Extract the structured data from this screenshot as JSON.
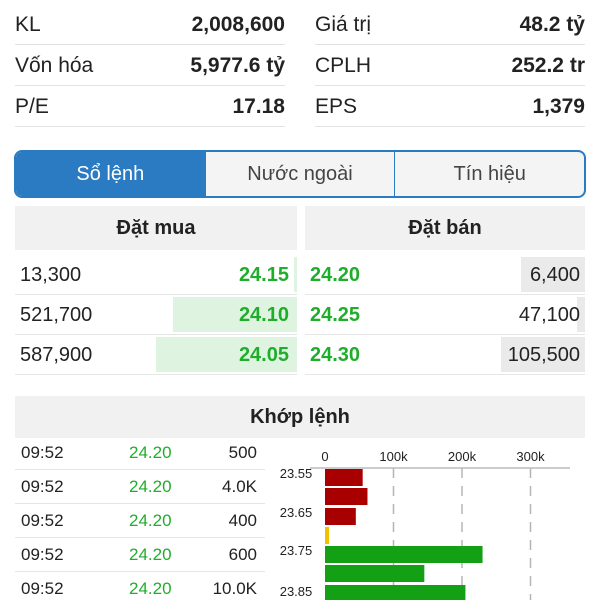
{
  "stats": {
    "left": [
      {
        "label": "KL",
        "value": "2,008,600"
      },
      {
        "label": "Vốn hóa",
        "value": "5,977.6 tỷ"
      },
      {
        "label": "P/E",
        "value": "17.18"
      }
    ],
    "right": [
      {
        "label": "Giá trị",
        "value": "48.2 tỷ"
      },
      {
        "label": "CPLH",
        "value": "252.2 tr"
      },
      {
        "label": "EPS",
        "value": "1,379"
      }
    ]
  },
  "tabs": [
    {
      "label": "Sổ lệnh",
      "active": true
    },
    {
      "label": "Nước ngoài",
      "active": false
    },
    {
      "label": "Tín hiệu",
      "active": false
    }
  ],
  "orderbook": {
    "buy_title": "Đặt mua",
    "sell_title": "Đặt bán",
    "buy": [
      {
        "volume": "13,300",
        "price": "24.15",
        "fill": 0.01
      },
      {
        "volume": "521,700",
        "price": "24.10",
        "fill": 0.44
      },
      {
        "volume": "587,900",
        "price": "24.05",
        "fill": 0.5
      }
    ],
    "sell": [
      {
        "price": "24.20",
        "volume": "6,400",
        "fill": 0.23
      },
      {
        "price": "24.25",
        "volume": "47,100",
        "fill": 0.03
      },
      {
        "price": "24.30",
        "volume": "105,500",
        "fill": 0.3
      }
    ]
  },
  "matched": {
    "title": "Khớp lệnh",
    "trades": [
      {
        "time": "09:52",
        "price": "24.20",
        "volume": "500"
      },
      {
        "time": "09:52",
        "price": "24.20",
        "volume": "4.0K"
      },
      {
        "time": "09:52",
        "price": "24.20",
        "volume": "400"
      },
      {
        "time": "09:52",
        "price": "24.20",
        "volume": "600"
      },
      {
        "time": "09:52",
        "price": "24.20",
        "volume": "10.0K"
      }
    ]
  },
  "chart_data": {
    "type": "bar",
    "orientation": "horizontal",
    "x_ticks": [
      "0",
      "100k",
      "200k",
      "300k"
    ],
    "xlim": [
      0,
      300000
    ],
    "y_labels": [
      "23.55",
      "23.65",
      "23.75",
      "23.85"
    ],
    "bars": [
      {
        "value": 55000,
        "color": "#a80000"
      },
      {
        "value": 62000,
        "color": "#a80000"
      },
      {
        "value": 45000,
        "color": "#a80000"
      },
      {
        "value": 6000,
        "color": "#f2c200"
      },
      {
        "value": 230000,
        "color": "#14a014"
      },
      {
        "value": 145000,
        "color": "#14a014"
      },
      {
        "value": 205000,
        "color": "#14a014"
      }
    ]
  },
  "colors": {
    "accent": "#2b7bc3",
    "up": "#1fae2b",
    "down": "#a80000",
    "ref": "#f2c200"
  }
}
